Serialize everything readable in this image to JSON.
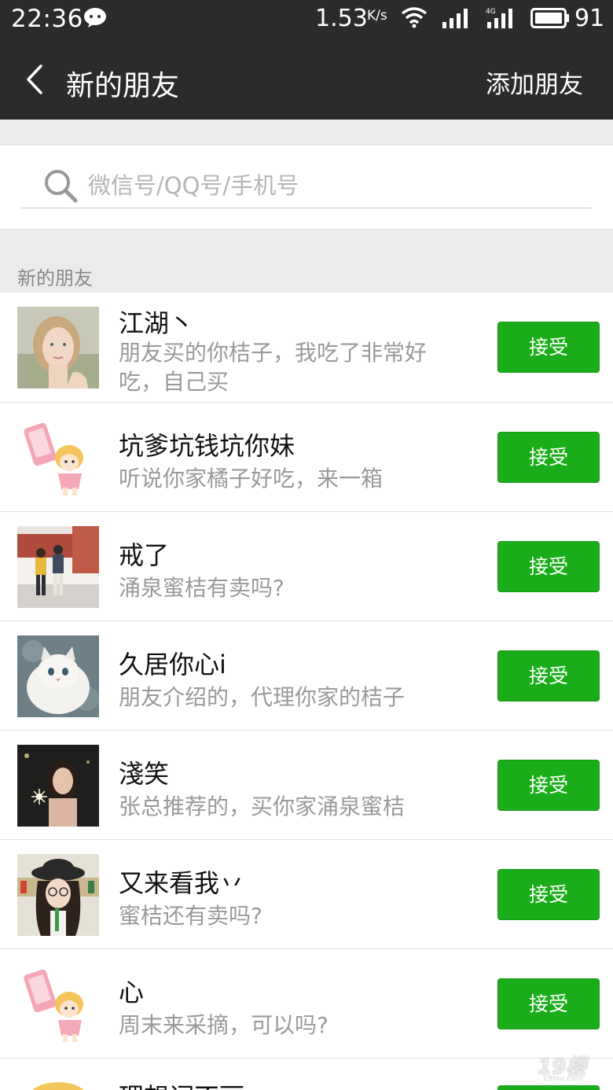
{
  "status_bar": {
    "time": "22:36",
    "network_speed": "1.53",
    "speed_unit": "K/s",
    "network_type": "4G",
    "battery": "91"
  },
  "nav": {
    "title": "新的朋友",
    "action": "添加朋友"
  },
  "search": {
    "placeholder": "微信号/QQ号/手机号"
  },
  "section": {
    "label": "新的朋友"
  },
  "requests": [
    {
      "name": "江湖丶",
      "message": "朋友买的你桔子，我吃了非常好吃，自己买",
      "button": "接受",
      "avatar": "girl-portrait-photo"
    },
    {
      "name": "坑爹坑钱坑你妹",
      "message": "听说你家橘子好吃，来一箱",
      "button": "接受",
      "avatar": "cartoon-girl-phone"
    },
    {
      "name": "戒了",
      "message": "涌泉蜜桔有卖吗?",
      "button": "接受",
      "avatar": "couple-street-photo"
    },
    {
      "name": "久居你心i",
      "message": "朋友介绍的，代理你家的桔子",
      "button": "接受",
      "avatar": "white-cat-photo"
    },
    {
      "name": "淺笑",
      "message": "张总推荐的，买你家涌泉蜜桔",
      "button": "接受",
      "avatar": "girl-sparkler-photo"
    },
    {
      "name": "又来看我丷",
      "message": "蜜桔还有卖吗?",
      "button": "接受",
      "avatar": "girl-hat-photo"
    },
    {
      "name": "心",
      "message": "周末来采摘，可以吗?",
      "button": "接受",
      "avatar": "cartoon-girl-phone"
    }
  ],
  "partial_row": {
    "name": "理想词不丽"
  },
  "watermark": {
    "text": "19楼",
    "sub": "19lou.com"
  },
  "colors": {
    "header_bg": "#2b2b2b",
    "accept_green": "#1aad19",
    "page_bg": "#ebebeb"
  }
}
